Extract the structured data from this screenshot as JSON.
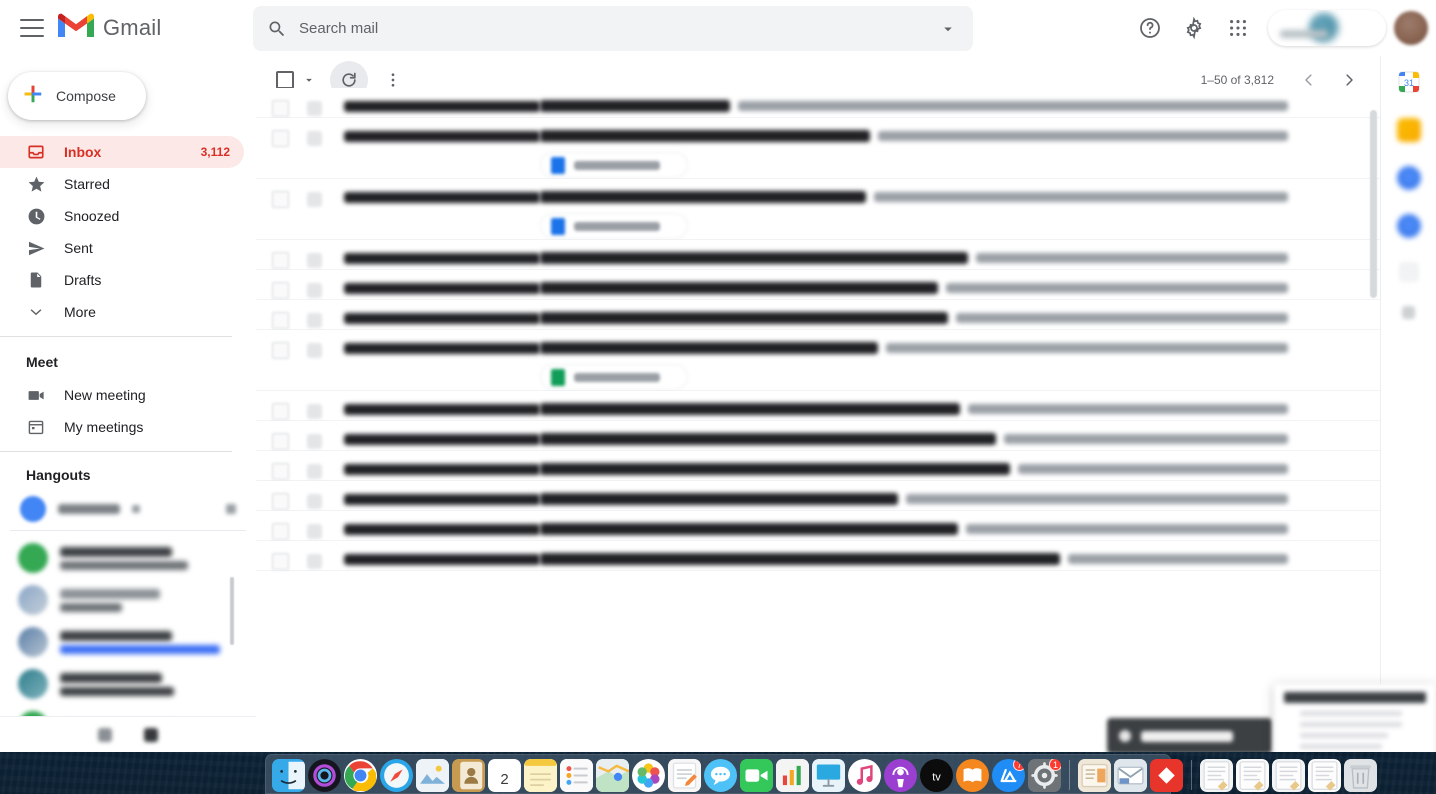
{
  "app": {
    "name": "Gmail",
    "logo_icon": "gmail-m-logo",
    "menu_icon": "hamburger-menu-icon"
  },
  "search": {
    "placeholder": "Search mail",
    "value": "",
    "icon": "search-icon",
    "options_icon": "chevron-down-icon"
  },
  "header_actions": [
    {
      "name": "support-button",
      "icon": "help-circle-icon"
    },
    {
      "name": "settings-button",
      "icon": "gear-icon"
    },
    {
      "name": "google-apps-button",
      "icon": "apps-grid-icon"
    }
  ],
  "account": {
    "chip_redacted": true,
    "avatar_icon": "user-avatar"
  },
  "compose": {
    "label": "Compose",
    "icon": "plus-icon"
  },
  "sidebar": {
    "items": [
      {
        "label": "Inbox",
        "count": "3,112",
        "icon": "inbox-icon",
        "active": true
      },
      {
        "label": "Starred",
        "count": "",
        "icon": "star-icon",
        "active": false
      },
      {
        "label": "Snoozed",
        "count": "",
        "icon": "clock-icon",
        "active": false
      },
      {
        "label": "Sent",
        "count": "",
        "icon": "send-icon",
        "active": false
      },
      {
        "label": "Drafts",
        "count": "",
        "icon": "draft-icon",
        "active": false
      },
      {
        "label": "More",
        "count": "",
        "icon": "chevron-down-icon",
        "active": false
      }
    ],
    "meet": {
      "title": "Meet",
      "items": [
        {
          "label": "New meeting",
          "icon": "video-camera-icon"
        },
        {
          "label": "My meetings",
          "icon": "calendar-icon"
        }
      ]
    },
    "hangouts": {
      "title": "Hangouts",
      "contacts_redacted": true
    }
  },
  "toolbar": {
    "select_all_icon": "checkbox-icon",
    "select_caret_icon": "chevron-down-icon",
    "refresh_icon": "refresh-icon",
    "more_icon": "more-vertical-icon",
    "pagination": "1–50 of 3,812",
    "prev_icon": "chevron-left-icon",
    "next_icon": "chevron-right-icon"
  },
  "mail_list": {
    "content_redacted": true,
    "rows": [
      {
        "sender_w": 160,
        "subject_w": 190,
        "snippet": true,
        "attachment": null,
        "partial_top": true
      },
      {
        "sender_w": 142,
        "subject_w": 330,
        "snippet": true,
        "attachment": "blue"
      },
      {
        "sender_w": 160,
        "subject_w": 326,
        "snippet": true,
        "attachment": "blue"
      },
      {
        "sender_w": 196,
        "subject_w": 428,
        "snippet": true,
        "attachment": null
      },
      {
        "sender_w": 196,
        "subject_w": 398,
        "snippet": true,
        "attachment": null
      },
      {
        "sender_w": 196,
        "subject_w": 408,
        "snippet": true,
        "attachment": null
      },
      {
        "sender_w": 184,
        "subject_w": 338,
        "snippet": true,
        "attachment": "green"
      },
      {
        "sender_w": 196,
        "subject_w": 420,
        "snippet": true,
        "attachment": null
      },
      {
        "sender_w": 150,
        "subject_w": 456,
        "snippet": true,
        "attachment": null
      },
      {
        "sender_w": 186,
        "subject_w": 470,
        "snippet": true,
        "attachment": null
      },
      {
        "sender_w": 152,
        "subject_w": 358,
        "snippet": true,
        "attachment": null
      },
      {
        "sender_w": 162,
        "subject_w": 418,
        "snippet": true,
        "attachment": null
      },
      {
        "sender_w": 168,
        "subject_w": 520,
        "snippet": true,
        "attachment": null
      }
    ]
  },
  "side_panel": {
    "items": [
      {
        "name": "google-calendar-icon",
        "label": "31"
      },
      {
        "name": "google-keep-icon",
        "label": ""
      },
      {
        "name": "google-tasks-icon",
        "label": ""
      },
      {
        "name": "google-contacts-icon",
        "label": ""
      },
      {
        "name": "add-ons-icon",
        "label": ""
      },
      {
        "name": "add-app-icon",
        "label": ""
      }
    ]
  },
  "overlays": {
    "toast_redacted": true,
    "popup_redacted": true
  },
  "dock": {
    "items": [
      {
        "name": "finder",
        "color": "#2f9ae0",
        "glyph": "☺",
        "running": true,
        "badge": ""
      },
      {
        "name": "siri",
        "color": "#1d1d28",
        "glyph": "",
        "running": false,
        "badge": "",
        "round": true
      },
      {
        "name": "google-chrome",
        "color": "#ffffff",
        "glyph": "",
        "running": true,
        "badge": "",
        "round": true
      },
      {
        "name": "safari",
        "color": "#2aa6e8",
        "glyph": "",
        "running": false,
        "badge": "",
        "round": true
      },
      {
        "name": "preview",
        "color": "#e8edf2",
        "glyph": "",
        "running": false,
        "badge": ""
      },
      {
        "name": "contacts",
        "color": "#c79a52",
        "glyph": "",
        "running": true,
        "badge": ""
      },
      {
        "name": "calendar",
        "color": "#ffffff",
        "glyph": "2",
        "running": false,
        "badge": ""
      },
      {
        "name": "notes",
        "color": "#fdf3c8",
        "glyph": "",
        "running": true,
        "badge": ""
      },
      {
        "name": "reminders",
        "color": "#f5f5f5",
        "glyph": "",
        "running": false,
        "badge": ""
      },
      {
        "name": "maps",
        "color": "#e6eef0",
        "glyph": "",
        "running": false,
        "badge": ""
      },
      {
        "name": "photos",
        "color": "#ffffff",
        "glyph": "",
        "running": false,
        "badge": "",
        "round": true
      },
      {
        "name": "pages",
        "color": "#f2883c",
        "glyph": "",
        "running": true,
        "badge": ""
      },
      {
        "name": "messages",
        "color": "#4ec2f7",
        "glyph": "",
        "running": true,
        "badge": "",
        "round": true
      },
      {
        "name": "facetime",
        "color": "#34c759",
        "glyph": "",
        "running": false,
        "badge": ""
      },
      {
        "name": "numbers",
        "color": "#f4f4f4",
        "glyph": "",
        "running": false,
        "badge": ""
      },
      {
        "name": "keynote",
        "color": "#2aa8e0",
        "glyph": "",
        "running": false,
        "badge": ""
      },
      {
        "name": "itunes",
        "color": "#ffffff",
        "glyph": "",
        "running": false,
        "badge": "",
        "round": true
      },
      {
        "name": "podcasts",
        "color": "#9b3fd1",
        "glyph": "",
        "running": false,
        "badge": "",
        "round": true
      },
      {
        "name": "apple-tv",
        "color": "#0c0c0c",
        "glyph": "",
        "running": false,
        "badge": "",
        "round": true
      },
      {
        "name": "books",
        "color": "#f5871f",
        "glyph": "",
        "running": false,
        "badge": "",
        "round": true
      },
      {
        "name": "app-store",
        "color": "#1f8df5",
        "glyph": "",
        "running": false,
        "badge": "7",
        "round": true
      },
      {
        "name": "system-preferences",
        "color": "#6e7377",
        "glyph": "",
        "running": false,
        "badge": "1"
      },
      {
        "name": "separator-1",
        "color": "",
        "glyph": "",
        "running": false,
        "badge": "",
        "separator": true
      },
      {
        "name": "stocks-folder",
        "color": "#efe7d8",
        "glyph": "",
        "running": true,
        "badge": ""
      },
      {
        "name": "mail-archive",
        "color": "#dfe6ec",
        "glyph": "",
        "running": false,
        "badge": ""
      },
      {
        "name": "red-app",
        "color": "#e8352b",
        "glyph": "◆",
        "running": true,
        "badge": ""
      },
      {
        "name": "separator-2",
        "color": "",
        "glyph": "",
        "running": false,
        "badge": "",
        "separator": true
      },
      {
        "name": "documents-stack-1",
        "color": "#f3f4f5",
        "glyph": "",
        "running": false,
        "badge": ""
      },
      {
        "name": "documents-stack-2",
        "color": "#fbfbfb",
        "glyph": "",
        "running": false,
        "badge": ""
      },
      {
        "name": "documents-stack-3",
        "color": "#f3f4f5",
        "glyph": "",
        "running": false,
        "badge": ""
      },
      {
        "name": "documents-stack-4",
        "color": "#fbfbfb",
        "glyph": "",
        "running": false,
        "badge": ""
      },
      {
        "name": "trash",
        "color": "#dfe3e6",
        "glyph": "",
        "running": false,
        "badge": ""
      }
    ]
  }
}
